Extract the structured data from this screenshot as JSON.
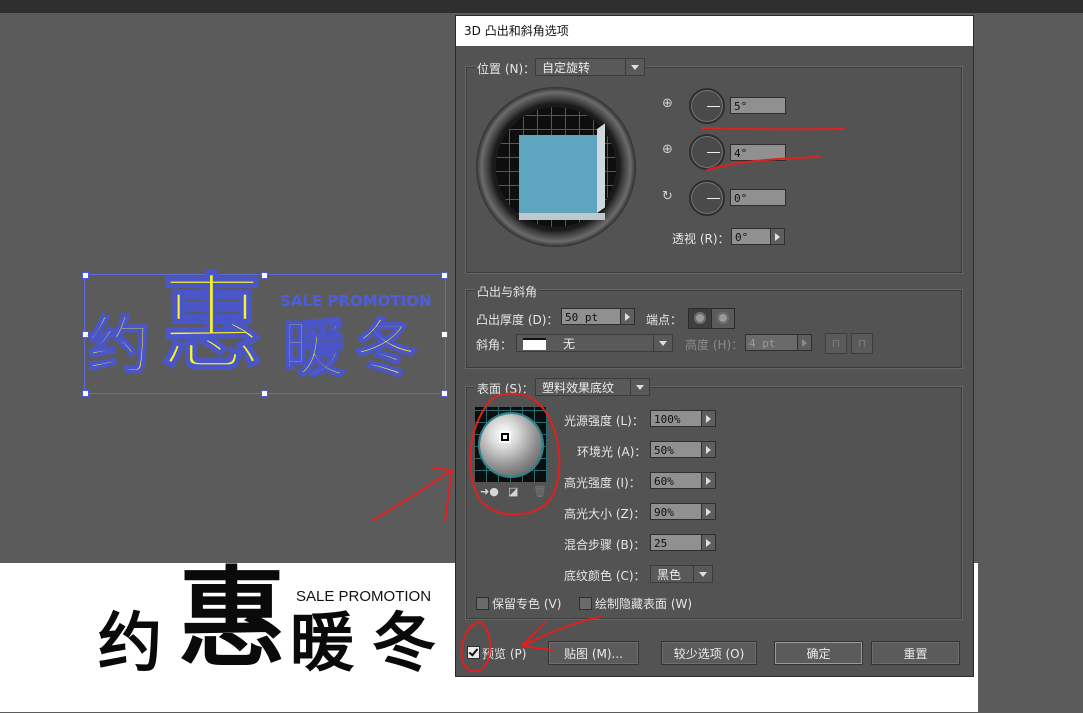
{
  "artboard": {
    "color_art_chars": [
      "约",
      "惠",
      "暖",
      "冬"
    ],
    "color_art_subtitle": "SALE PROMOTION",
    "bw_art_chars": [
      "约",
      "惠",
      "暖",
      "冬"
    ],
    "bw_art_subtitle": "SALE PROMOTION"
  },
  "dialog": {
    "title": "3D 凸出和斜角选项",
    "position": {
      "label": "位置 (N)：",
      "preset": "自定旋转",
      "rot_x": "5°",
      "rot_y": "4°",
      "rot_z": "0°",
      "perspective_label": "透视 (R)：",
      "perspective": "0°"
    },
    "extrude": {
      "legend": "凸出与斜角",
      "depth_label": "凸出厚度 (D)：",
      "depth": "50 pt",
      "cap_label": "端点：",
      "bevel_label": "斜角：",
      "bevel_value": "无",
      "height_label": "高度 (H)：",
      "height": "4 pt"
    },
    "surface": {
      "label": "表面 (S)：",
      "preset": "塑料效果底纹",
      "light_intensity_label": "光源强度 (L)：",
      "light_intensity": "100%",
      "ambient_label": "环境光 (A)：",
      "ambient": "50%",
      "highlight_intensity_label": "高光强度 (I)：",
      "highlight_intensity": "60%",
      "highlight_size_label": "高光大小 (Z)：",
      "highlight_size": "90%",
      "blend_steps_label": "混合步骤 (B)：",
      "blend_steps": "25",
      "shading_color_label": "底纹颜色 (C)：",
      "shading_color": "黑色"
    },
    "options": {
      "preserve_spot": "保留专色 (V)",
      "draw_hidden": "绘制隐藏表面 (W)"
    },
    "footer": {
      "preview": "预览 (P)",
      "map": "贴图 (M)...",
      "fewer": "较少选项 (O)",
      "ok": "确定",
      "reset": "重置"
    }
  },
  "colors": {
    "canvas_bg": "#5b5b5b",
    "dialog_bg": "#535353",
    "art_yellow": "#f7f22a",
    "art_outline": "#4a56c8",
    "annotation_red": "#e0201f",
    "cube_face": "#5ea6bf"
  }
}
